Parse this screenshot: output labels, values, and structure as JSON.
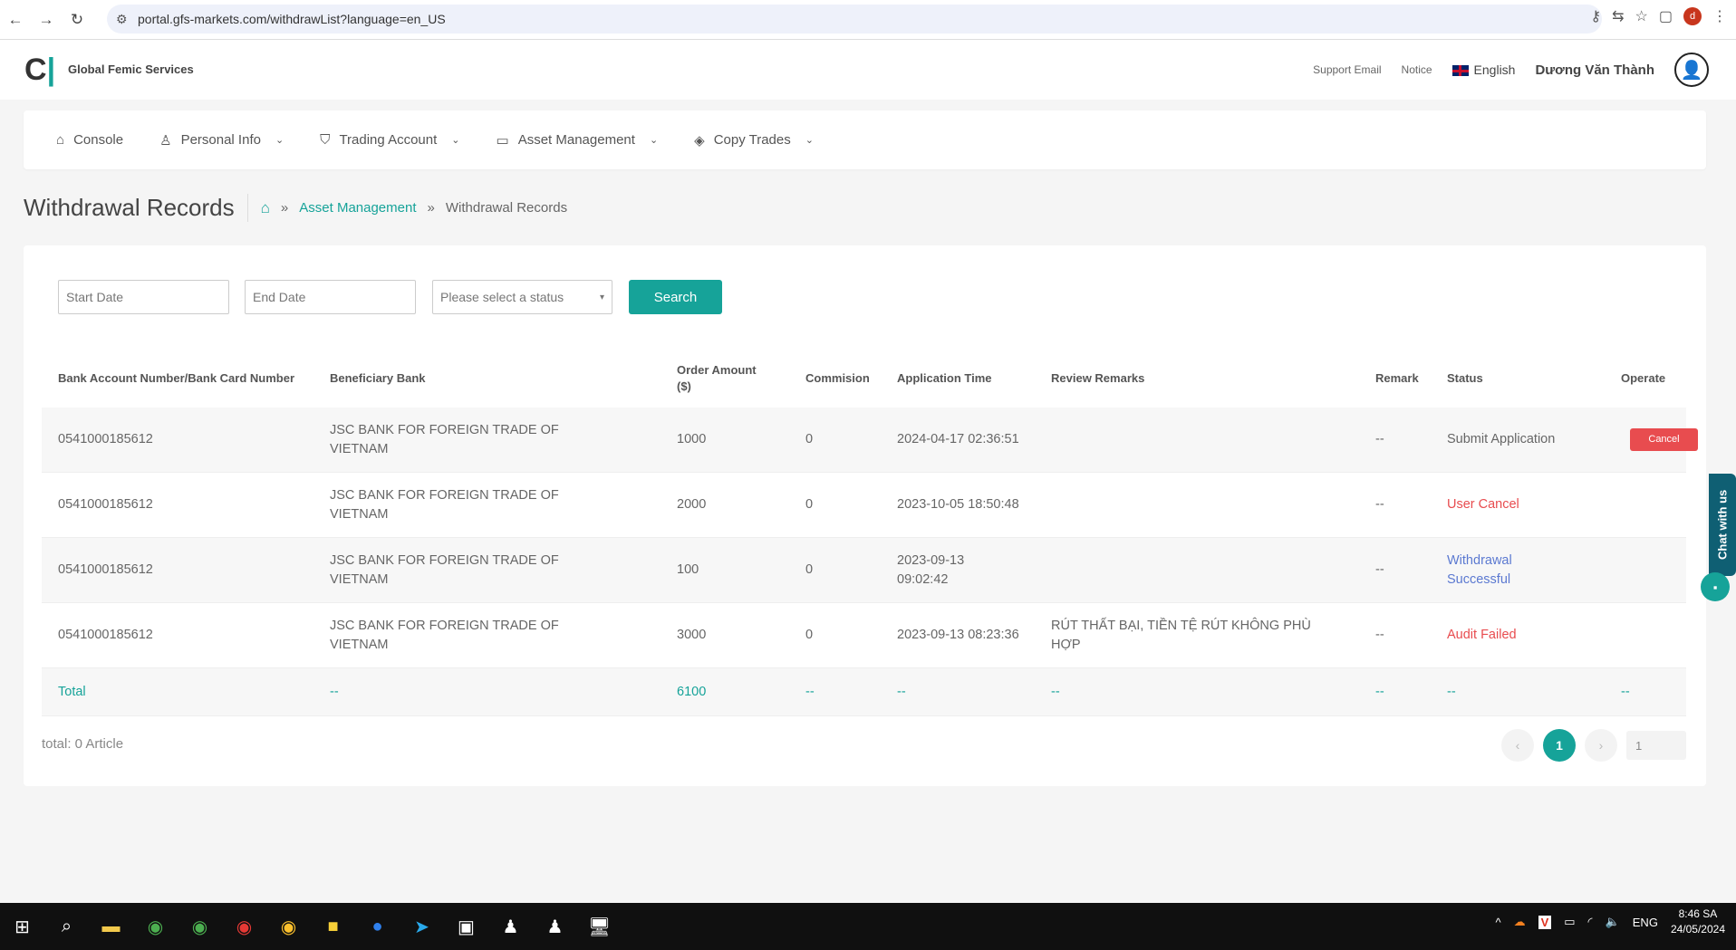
{
  "browser": {
    "url": "portal.gfs-markets.com/withdrawList?language=en_US",
    "profile_initial": "d"
  },
  "header": {
    "logo": "G",
    "brand": "Global Femic Services",
    "support": "Support Email",
    "notice": "Notice",
    "language": "English",
    "user": "Dương Văn Thành"
  },
  "nav": [
    {
      "label": "Console"
    },
    {
      "label": "Personal Info"
    },
    {
      "label": "Trading Account"
    },
    {
      "label": "Asset Management"
    },
    {
      "label": "Copy Trades"
    }
  ],
  "page": {
    "title": "Withdrawal Records",
    "breadcrumb": [
      "Asset Management",
      "Withdrawal Records"
    ],
    "sep": "»"
  },
  "filters": {
    "start_placeholder": "Start Date",
    "end_placeholder": "End Date",
    "status_placeholder": "Please select a status",
    "search": "Search"
  },
  "table": {
    "headers": [
      "Bank Account Number/Bank Card Number",
      "Beneficiary Bank",
      "Order Amount ($)",
      "Commision",
      "Application Time",
      "Review Remarks",
      "Remark",
      "Status",
      "Operate"
    ],
    "rows": [
      {
        "account": "0541000185612",
        "bank": "JSC BANK FOR FOREIGN TRADE OF VIETNAM",
        "amount": "1000",
        "commission": "0",
        "time": "2024-04-17 02:36:51",
        "review": "",
        "remark": "--",
        "status": "Submit Application",
        "operate": "Cancel"
      },
      {
        "account": "0541000185612",
        "bank": "JSC BANK FOR FOREIGN TRADE OF VIETNAM",
        "amount": "2000",
        "commission": "0",
        "time": "2023-10-05 18:50:48",
        "review": "",
        "remark": "--",
        "status": "User Cancel",
        "operate": ""
      },
      {
        "account": "0541000185612",
        "bank": "JSC BANK FOR FOREIGN TRADE OF VIETNAM",
        "amount": "100",
        "commission": "0",
        "time": "2023-09-13 09:02:42",
        "review": "",
        "remark": "--",
        "status": "Withdrawal Successful",
        "operate": ""
      },
      {
        "account": "0541000185612",
        "bank": "JSC BANK FOR FOREIGN TRADE OF VIETNAM",
        "amount": "3000",
        "commission": "0",
        "time": "2023-09-13 08:23:36",
        "review": "RÚT THẤT BẠI, TIỀN TỆ RÚT KHÔNG PHÙ HỢP",
        "remark": "--",
        "status": "Audit Failed",
        "operate": ""
      }
    ],
    "total": {
      "label": "Total",
      "amount": "6100",
      "dash": "--"
    }
  },
  "footer": {
    "total_text": "total:  0 Article",
    "page": "1",
    "jump": "1"
  },
  "chat": {
    "label": "Chat with us"
  },
  "taskbar": {
    "time": "8:46 SA",
    "date": "24/05/2024",
    "lang": "ENG"
  }
}
